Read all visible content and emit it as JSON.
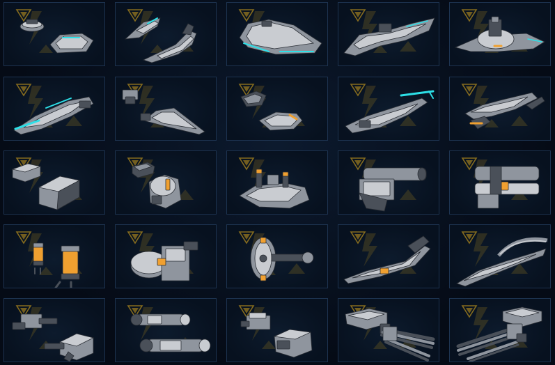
{
  "grid": {
    "rows": 5,
    "columns": 5,
    "tiles": [
      {
        "row": 1,
        "col": 1,
        "icon": "saucer-hull-pair-icon",
        "kind": "saucer",
        "accent": "#2de0e8"
      },
      {
        "row": 1,
        "col": 2,
        "icon": "wing-fighter-pair-icon",
        "kind": "wings",
        "accent": "#2de0e8"
      },
      {
        "row": 1,
        "col": 3,
        "icon": "cruiser-hull-icon",
        "kind": "cruiser",
        "accent": "#2de0e8"
      },
      {
        "row": 1,
        "col": 4,
        "icon": "winged-frigate-icon",
        "kind": "frigate",
        "accent": "#2de0e8"
      },
      {
        "row": 1,
        "col": 5,
        "icon": "tower-frigate-icon",
        "kind": "tower",
        "accent": "#f0a030"
      },
      {
        "row": 2,
        "col": 1,
        "icon": "lance-hull-icon",
        "kind": "lance",
        "accent": "#2de0e8"
      },
      {
        "row": 2,
        "col": 2,
        "icon": "delta-wing-pair-icon",
        "kind": "delta",
        "accent": "#2de0e8"
      },
      {
        "row": 2,
        "col": 3,
        "icon": "armored-pod-pair-icon",
        "kind": "pods",
        "accent": "#f0a030"
      },
      {
        "row": 2,
        "col": 4,
        "icon": "blade-gunship-icon",
        "kind": "blade",
        "accent": "#2de0e8"
      },
      {
        "row": 2,
        "col": 5,
        "icon": "talon-gunship-icon",
        "kind": "talon",
        "accent": "#f0a030"
      },
      {
        "row": 3,
        "col": 1,
        "icon": "armor-block-pair-icon",
        "kind": "blocks",
        "accent": "#8a8f98"
      },
      {
        "row": 3,
        "col": 2,
        "icon": "reactor-module-pair-icon",
        "kind": "reactor",
        "accent": "#f0a030"
      },
      {
        "row": 3,
        "col": 3,
        "icon": "missile-battery-icon",
        "kind": "battery",
        "accent": "#f0a030"
      },
      {
        "row": 3,
        "col": 4,
        "icon": "cannon-block-icon",
        "kind": "cannon",
        "accent": "#8a8f98"
      },
      {
        "row": 3,
        "col": 5,
        "icon": "heavy-cannon-block-icon",
        "kind": "heavycannon",
        "accent": "#f0a030"
      },
      {
        "row": 4,
        "col": 1,
        "icon": "fuel-cell-pair-icon",
        "kind": "cells",
        "accent": "#f0a030"
      },
      {
        "row": 4,
        "col": 2,
        "icon": "drum-generator-icon",
        "kind": "drum",
        "accent": "#f0a030"
      },
      {
        "row": 4,
        "col": 3,
        "icon": "rotor-turret-icon",
        "kind": "rotor",
        "accent": "#f0a030"
      },
      {
        "row": 4,
        "col": 4,
        "icon": "rail-gun-icon",
        "kind": "rail",
        "accent": "#f0a030"
      },
      {
        "row": 4,
        "col": 5,
        "icon": "scythe-rail-icon",
        "kind": "scythe",
        "accent": "#8a8f98"
      },
      {
        "row": 5,
        "col": 1,
        "icon": "gun-turret-pair-icon",
        "kind": "turrets",
        "accent": "#8a8f98"
      },
      {
        "row": 5,
        "col": 2,
        "icon": "barrel-cannon-pair-icon",
        "kind": "barrels",
        "accent": "#8a8f98"
      },
      {
        "row": 5,
        "col": 3,
        "icon": "compact-turret-pair-icon",
        "kind": "compact",
        "accent": "#8a8f98"
      },
      {
        "row": 5,
        "col": 4,
        "icon": "gatling-twin-icon",
        "kind": "gatling",
        "accent": "#8a8f98"
      },
      {
        "row": 5,
        "col": 5,
        "icon": "gatling-heavy-icon",
        "kind": "gatling2",
        "accent": "#8a8f98"
      }
    ]
  },
  "colors": {
    "background": "#050b16",
    "tile_border": "#1d3350",
    "emblem": "#b08a1e",
    "hull_light": "#c9ccd1",
    "hull_mid": "#8f959e",
    "hull_dark": "#4a5059"
  }
}
